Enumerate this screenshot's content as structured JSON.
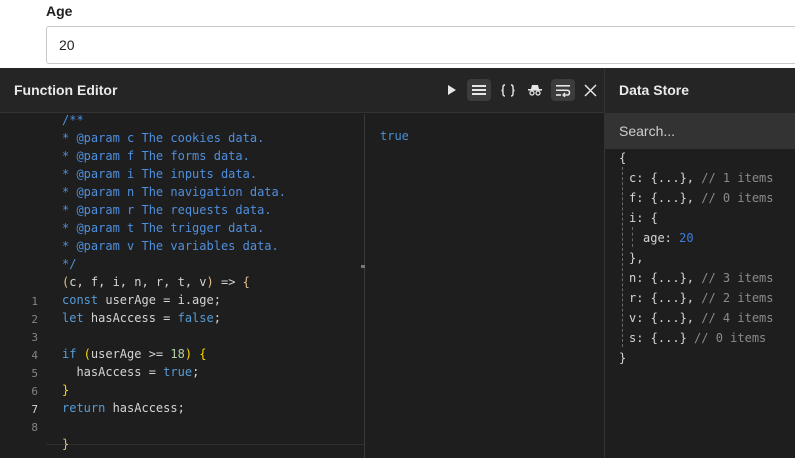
{
  "form": {
    "age_label": "Age",
    "age_value": "20"
  },
  "editor": {
    "title": "Function Editor",
    "toolbar_icons": [
      "play-icon",
      "list-icon",
      "braces-icon",
      "incognito-icon",
      "wrap-icon",
      "close-icon"
    ],
    "line_numbers": [
      "1",
      "2",
      "3",
      "4",
      "5",
      "6",
      "7",
      "8"
    ],
    "comment": [
      "/**",
      "* @param c The cookies data.",
      "* @param f The forms data.",
      "* @param i The inputs data.",
      "* @param n The navigation data.",
      "* @param r The requests data.",
      "* @param t The trigger data.",
      "* @param v The variables data.",
      "*/"
    ],
    "signature": {
      "open": "(",
      "params": "c, f, i, n, r, t, v",
      "close": ")",
      "arrow": " => ",
      "brace": "{"
    },
    "code": {
      "l1_kw": "const",
      "l1_rest": " userAge = i.age;",
      "l2_kw": "let",
      "l2_rest": " hasAccess = ",
      "l2_val": "false",
      "l2_end": ";",
      "l4_kw": "if",
      "l4_open": " (",
      "l4_cond": "userAge >= ",
      "l4_num": "18",
      "l4_close": ") ",
      "l4_brace": "{",
      "l5_rest": "  hasAccess = ",
      "l5_val": "true",
      "l5_end": ";",
      "l6_brace": "}",
      "l7_kw": "return",
      "l7_rest": " hasAccess;",
      "closing_brace": "}"
    },
    "output": "true"
  },
  "store": {
    "title": "Data Store",
    "search_placeholder": "Search...",
    "tree": {
      "open": "{",
      "c_key": "c:",
      "c_val": " {...},",
      "c_cmt": " // 1 items",
      "f_key": "f:",
      "f_val": " {...},",
      "f_cmt": " // 0 items",
      "i_key": "i:",
      "i_val": " {",
      "age_key": "age:",
      "age_val": "20",
      "i_close": "},",
      "n_key": "n:",
      "n_val": " {...},",
      "n_cmt": " // 3 items",
      "r_key": "r:",
      "r_val": " {...},",
      "r_cmt": " // 2 items",
      "v_key": "v:",
      "v_val": " {...},",
      "v_cmt": " // 4 items",
      "s_key": "s:",
      "s_val": " {...}",
      "s_cmt": " // 0 items",
      "close": "}"
    }
  }
}
